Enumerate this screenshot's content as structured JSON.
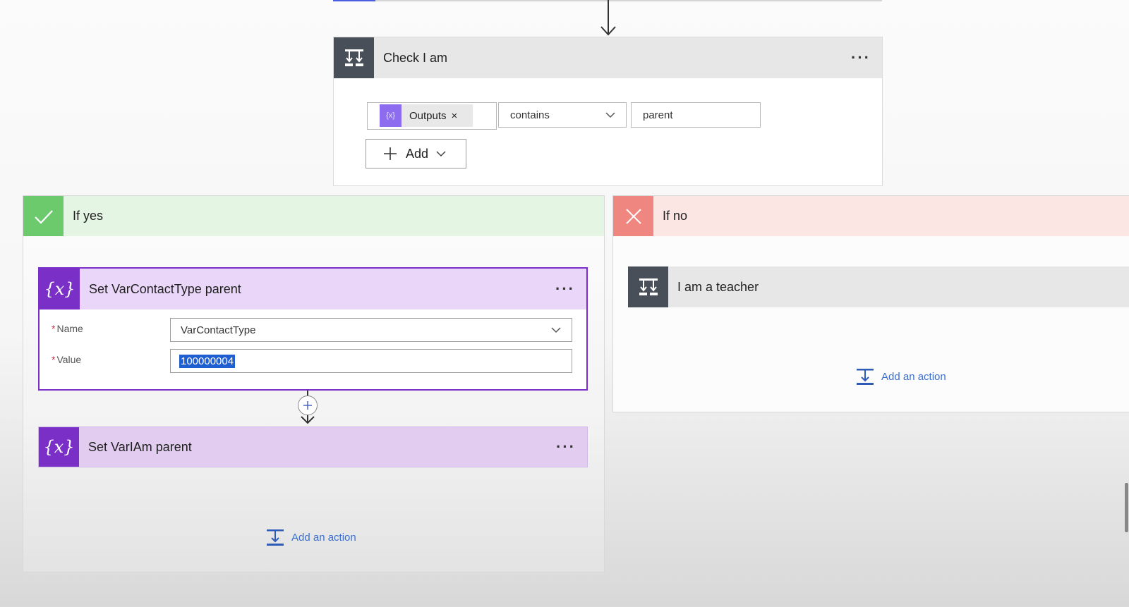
{
  "condition": {
    "title": "Check I am",
    "token_label": "Outputs",
    "token_remove": "×",
    "token_icon": "variable-token-icon",
    "operator": "contains",
    "value": "parent",
    "add_label": "Add",
    "menu": "···"
  },
  "if_yes": {
    "label": "If yes",
    "color": "#6cc96c",
    "actions": [
      {
        "title": "Set VarContactType parent",
        "menu": "···",
        "name_label": "Name",
        "name_value": "VarContactType",
        "value_label": "Value",
        "value_value": "100000004"
      },
      {
        "title": "Set VarIAm parent",
        "menu": "···"
      }
    ],
    "add_action": "Add an action"
  },
  "if_no": {
    "label": "If no",
    "color": "#f08680",
    "actions": [
      {
        "title": "I am a teacher"
      }
    ],
    "add_action": "Add an action"
  },
  "icons": {
    "variable": "{x}",
    "condition": "condition-icon",
    "check": "check-icon",
    "close": "close-icon",
    "insert": "plus-circle-icon"
  },
  "colors": {
    "variable": "#7a2fc7",
    "variable_header": "#ead6f8",
    "condition_icon": "#484f58",
    "selected_border": "#7b2fc9",
    "link": "#3a6fd0"
  },
  "required_marker": "*"
}
